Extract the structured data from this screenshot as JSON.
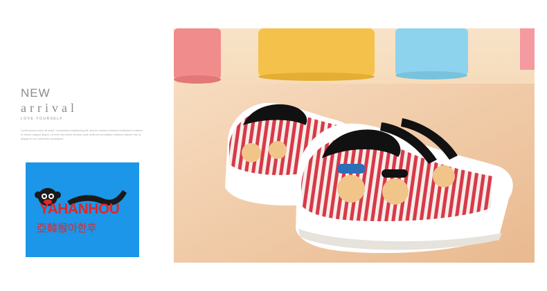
{
  "promo": {
    "title_line1": "NEW",
    "title_line2": "arrival",
    "tagline": "LOVE YOURSELF",
    "body_text": "Lorem ipsum dolor sit amet, consectetur adipisicing elit, sed do eiusmod tempor incididunt ut labore et dolore magna aliqua. Ut enim ad minim veniam, quis nostrud exercitation ullamco laboris nisi ut aliquip ex ea commodo consequat."
  },
  "logo": {
    "brand_name": "YAHANHOU",
    "brand_subtitle": "亞韓猴아한후",
    "background_color": "#1b96e8",
    "brand_color": "#e0262b",
    "icon": "monkey-face-icon"
  },
  "photo": {
    "subject": "kids-canvas-sneakers-image",
    "cylinder_colors": [
      "#f08c8c",
      "#f4c24a",
      "#8ed3ee",
      "#f49aa0"
    ]
  }
}
